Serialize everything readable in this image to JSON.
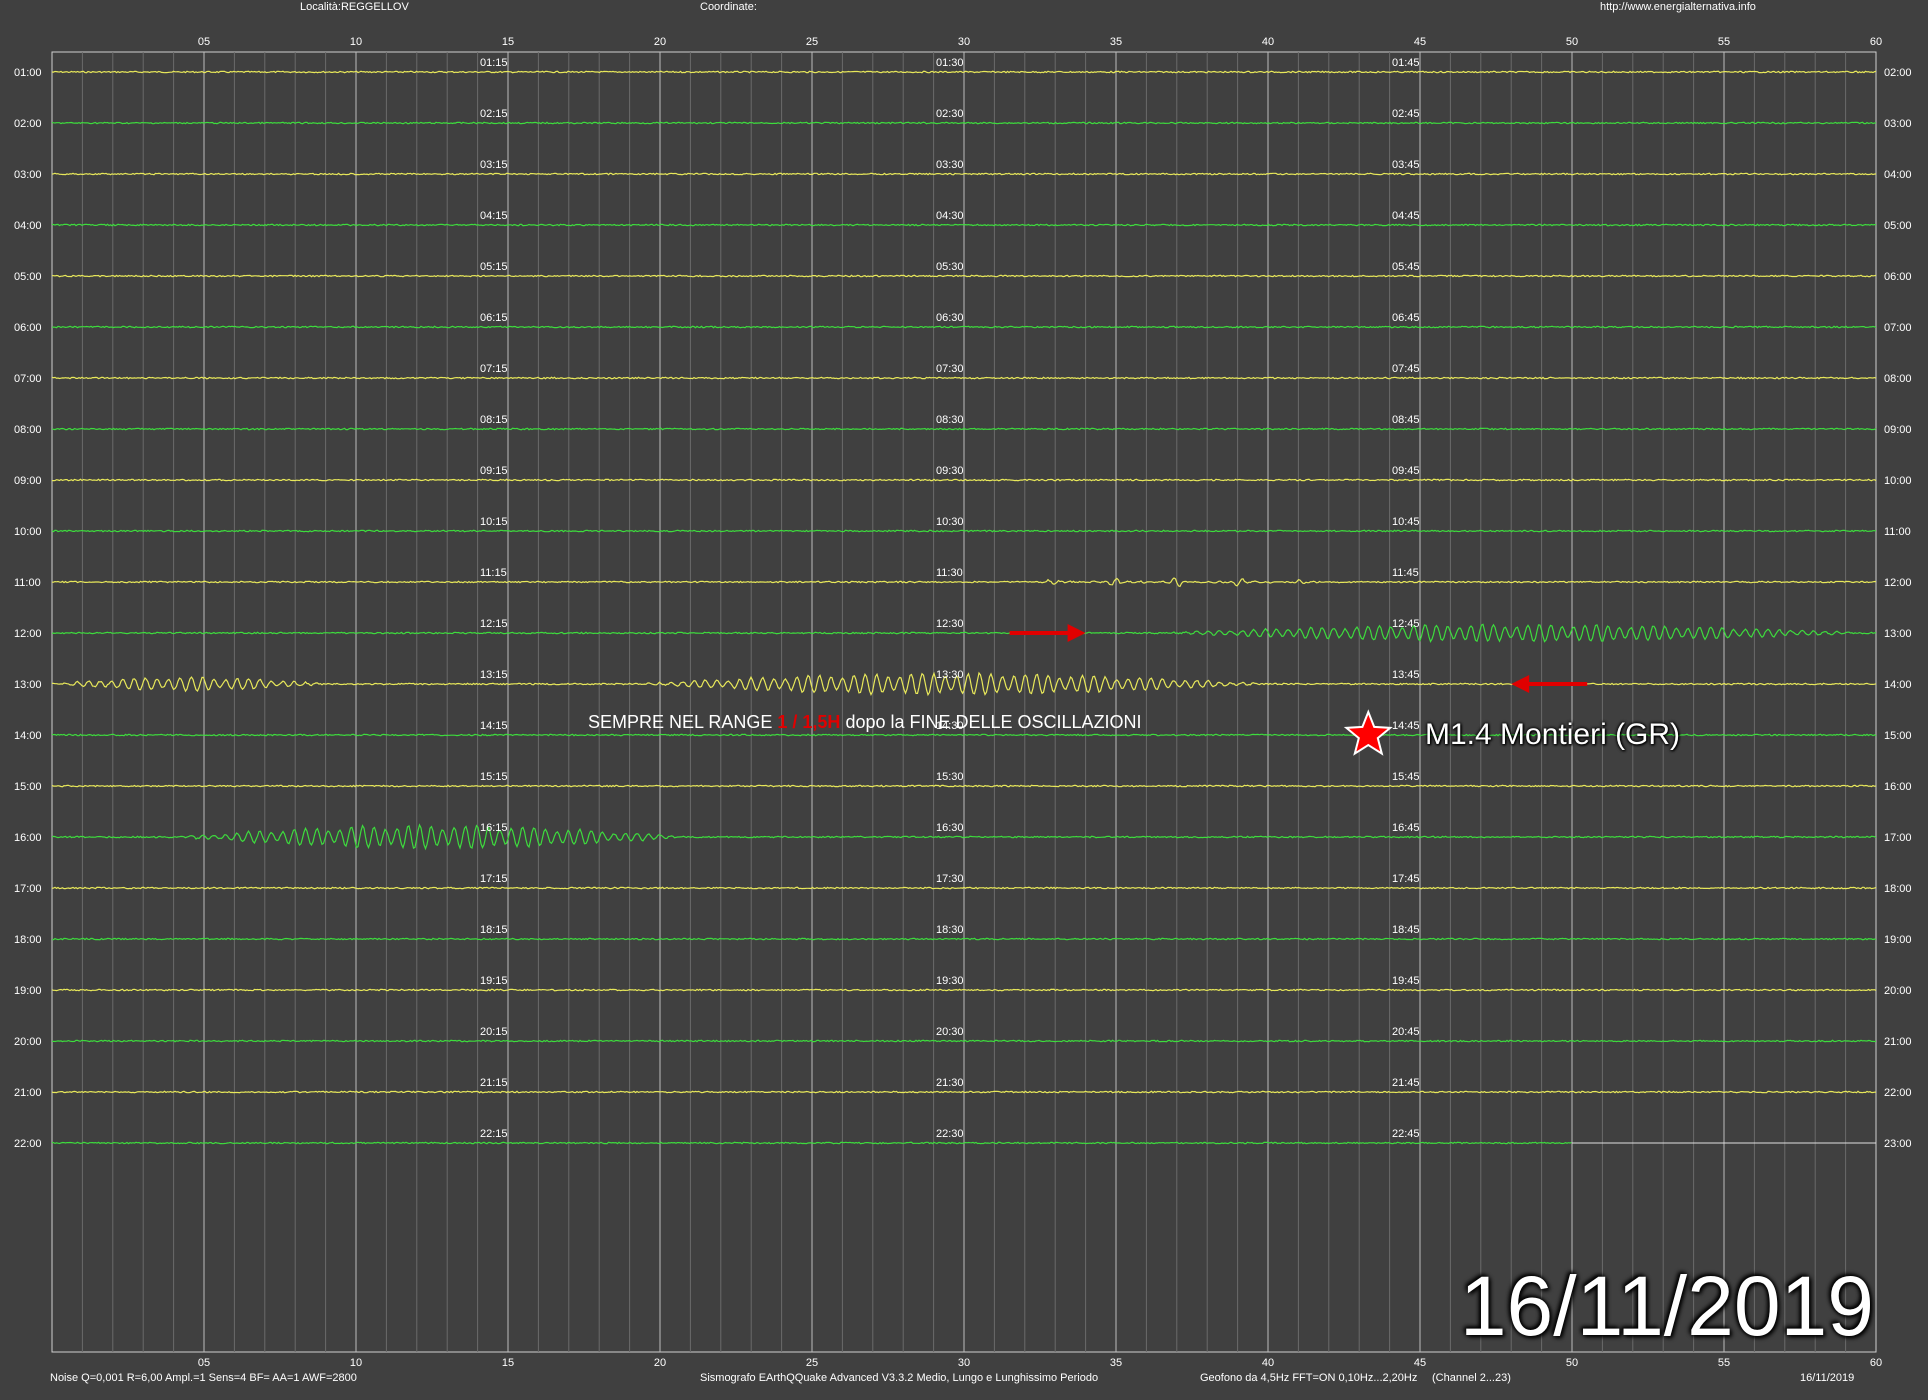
{
  "header": {
    "location": "Località:REGGELLOV",
    "coordinates": "Coordinate:",
    "url": "http://www.energialternativa.info"
  },
  "footer": {
    "noise": "Noise Q=0,001 R=6,00 Ampl.=1 Sens=4 BF= AA=1 AWF=2800",
    "software": "Sismografo  EArthQQuake Advanced V3.3.2  Medio, Lungo e Lunghissimo Periodo",
    "geofono": "Geofono da 4,5Hz FFT=ON 0,10Hz...2,20Hz",
    "channel": "(Channel 2...23)",
    "date": "16/11/2019"
  },
  "annotation": {
    "prefix": "SEMPRE NEL RANGE ",
    "highlight": "1 / 1,5H",
    "suffix": " dopo la FINE DELLE OSCILLAZIONI"
  },
  "quake_label": "M1.4 Montieri (GR)",
  "big_date": "16/11/2019",
  "colors": {
    "background": "#404040",
    "trace_yellow": "#e8e85a",
    "trace_green": "#3ddc3d",
    "grid": "#9a9a9a",
    "arrow": "#e00000",
    "star": "#ff0000"
  },
  "chart_data": {
    "type": "line",
    "title": "",
    "xlabel": "",
    "ylabel": "",
    "x_ticks": [
      "05",
      "10",
      "15",
      "20",
      "25",
      "30",
      "35",
      "40",
      "45",
      "50",
      "55",
      "60"
    ],
    "xlim": [
      0,
      60
    ],
    "left_labels": [
      "01:00",
      "02:00",
      "03:00",
      "04:00",
      "05:00",
      "06:00",
      "07:00",
      "08:00",
      "09:00",
      "10:00",
      "11:00",
      "12:00",
      "13:00",
      "14:00",
      "15:00",
      "16:00",
      "17:00",
      "18:00",
      "19:00",
      "20:00",
      "21:00",
      "22:00"
    ],
    "right_labels": [
      "02:00",
      "03:00",
      "04:00",
      "05:00",
      "06:00",
      "07:00",
      "08:00",
      "09:00",
      "10:00",
      "11:00",
      "12:00",
      "13:00",
      "14:00",
      "15:00",
      "16:00",
      "17:00",
      "18:00",
      "19:00",
      "20:00",
      "21:00",
      "22:00",
      "23:00"
    ],
    "quarter_labels": [
      [
        "01:15",
        "01:30",
        "01:45"
      ],
      [
        "02:15",
        "02:30",
        "02:45"
      ],
      [
        "03:15",
        "03:30",
        "03:45"
      ],
      [
        "04:15",
        "04:30",
        "04:45"
      ],
      [
        "05:15",
        "05:30",
        "05:45"
      ],
      [
        "06:15",
        "06:30",
        "06:45"
      ],
      [
        "07:15",
        "07:30",
        "07:45"
      ],
      [
        "08:15",
        "08:30",
        "08:45"
      ],
      [
        "09:15",
        "09:30",
        "09:45"
      ],
      [
        "10:15",
        "10:30",
        "10:45"
      ],
      [
        "11:15",
        "11:30",
        "11:45"
      ],
      [
        "12:15",
        "12:30",
        "12:45"
      ],
      [
        "13:15",
        "13:30",
        "13:45"
      ],
      [
        "14:15",
        "14:30",
        "14:45"
      ],
      [
        "15:15",
        "15:30",
        "15:45"
      ],
      [
        "16:15",
        "16:30",
        "16:45"
      ],
      [
        "17:15",
        "17:30",
        "17:45"
      ],
      [
        "18:15",
        "18:30",
        "18:45"
      ],
      [
        "19:15",
        "19:30",
        "19:45"
      ],
      [
        "20:15",
        "20:30",
        "20:45"
      ],
      [
        "21:15",
        "21:30",
        "21:45"
      ],
      [
        "22:15",
        "22:30",
        "22:45"
      ]
    ],
    "trace_end_minute": 60,
    "last_trace_end_minute": 50,
    "oscillation_events": [
      {
        "row": 10,
        "start": 31,
        "end": 43,
        "amp": 4,
        "burst": true
      },
      {
        "row": 11,
        "start": 36.5,
        "end": 60,
        "amp": 9
      },
      {
        "row": 12,
        "start": 0,
        "end": 9,
        "amp": 7
      },
      {
        "row": 12,
        "start": 19,
        "end": 40,
        "amp": 11
      },
      {
        "row": 15,
        "start": 4,
        "end": 21,
        "amp": 12
      }
    ],
    "arrows": [
      {
        "row": 11,
        "from": 31.5,
        "to": 34,
        "direction": "right"
      },
      {
        "row": 12,
        "from": 50.5,
        "to": 48,
        "direction": "left"
      }
    ],
    "event_marker": {
      "row": 13,
      "minute": 43.3,
      "label": "M1.4 Montieri (GR)"
    }
  }
}
